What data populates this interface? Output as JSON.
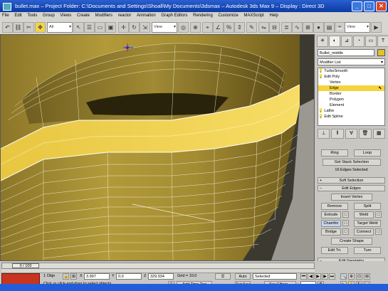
{
  "title": {
    "file": "bullet.max",
    "project": "Project Folder: C:\\Documents and Settings\\Shoall\\My Documents\\3dsmax",
    "app": "Autodesk 3ds Max 9",
    "display": "Display : Direct 3D"
  },
  "menu": [
    "File",
    "Edit",
    "Tools",
    "Group",
    "Views",
    "Create",
    "Modifiers",
    "reactor",
    "Animation",
    "Graph Editors",
    "Rendering",
    "Customize",
    "MAXScript",
    "Help"
  ],
  "toolbar": {
    "selection_filter": "All",
    "ref_coord": "View",
    "named_selection": "View"
  },
  "panel": {
    "object_name": "Bullet_middle",
    "modifier_list": "Modifier List",
    "stack": [
      {
        "label": "TurboSmooth",
        "level": 0,
        "selected": false
      },
      {
        "label": "Edit Poly",
        "level": 0,
        "selected": false
      },
      {
        "label": "Vertex",
        "level": 1,
        "selected": false
      },
      {
        "label": "Edge",
        "level": 1,
        "selected": true
      },
      {
        "label": "Border",
        "level": 1,
        "selected": false
      },
      {
        "label": "Polygon",
        "level": 1,
        "selected": false
      },
      {
        "label": "Element",
        "level": 1,
        "selected": false
      },
      {
        "label": "Lathe",
        "level": 0,
        "selected": false
      },
      {
        "label": "Edit Spline",
        "level": 0,
        "selected": false
      }
    ],
    "ring": "Ring",
    "loop": "Loop",
    "get_stack_selection": "Get Stack Selection",
    "edges_selected": "16 Edges Selected",
    "soft_selection": "Soft Selection",
    "edit_edges": "Edit Edges",
    "insert_vertex": "Insert Vertex",
    "remove": "Remove",
    "split": "Split",
    "extrude": "Extrude",
    "weld": "Weld",
    "chamfer": "Chamfer",
    "target_weld": "Target Weld",
    "bridge": "Bridge",
    "connect": "Connect",
    "create_shape": "Create Shape",
    "edit_tri": "Edit Tri.",
    "turn": "Turn",
    "edit_geometry": "Edit Geometry"
  },
  "bottom": {
    "time": "0 / 100",
    "objects": "1 Obje",
    "x_label": "X",
    "x_value": "3.997",
    "y_label": "Y",
    "y_value": "0.0",
    "z_label": "Z",
    "z_value": "329.934",
    "grid": "Grid = 10.0",
    "autokey": "Auto Key",
    "selected": "Selected",
    "setkey": "Set Key",
    "keyfilters": "Key Filters...",
    "prompt": "Click or click-and-drag to select objects",
    "add_time_tag": "Add Time Tag"
  }
}
